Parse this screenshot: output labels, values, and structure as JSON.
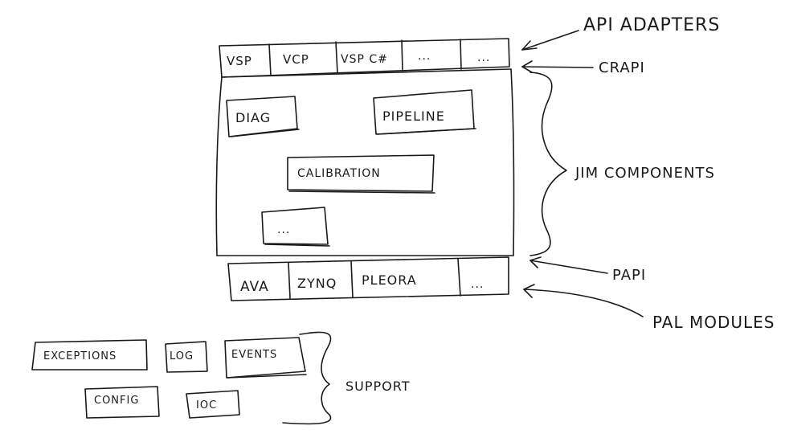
{
  "api_adapters": {
    "label": "API ADAPTERS",
    "tabs": [
      "VSP",
      "VCP",
      "VSP C#",
      "...",
      "..."
    ]
  },
  "crapi": {
    "label": "CRAPI"
  },
  "jim_components": {
    "label": "JIM COMPONENTS",
    "boxes": [
      "DIAG",
      "PIPELINE",
      "CALIBRATION",
      "..."
    ]
  },
  "papi": {
    "label": "PAPI"
  },
  "pal_modules": {
    "label": "PAL MODULES",
    "tabs": [
      "AVA",
      "ZYNQ",
      "PLEORA",
      "..."
    ]
  },
  "support": {
    "label": "SUPPORT",
    "boxes": [
      "EXCEPTIONS",
      "LOG",
      "EVENTS",
      "CONFIG",
      "IOC"
    ]
  }
}
